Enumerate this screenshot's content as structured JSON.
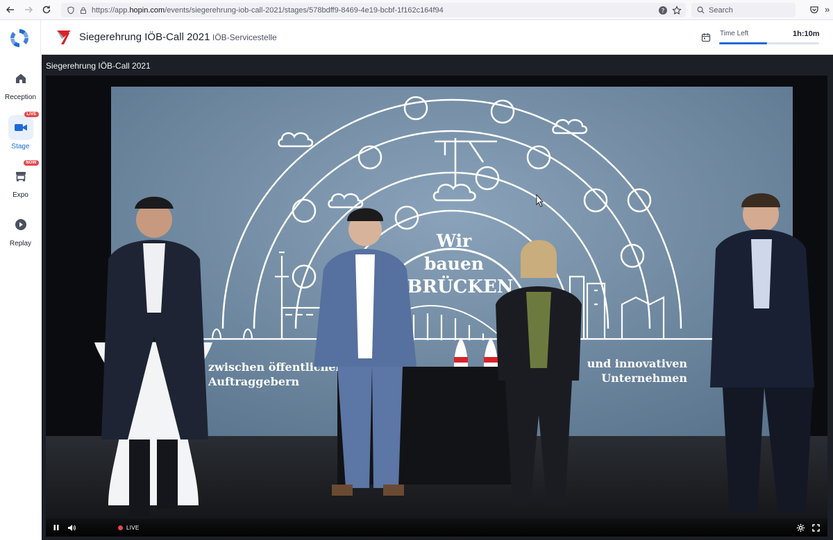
{
  "browser": {
    "url_prefix": "https://app.",
    "url_domain": "hopin.com",
    "url_path": "/events/siegerehrung-iob-call-2021/stages/578bdff9-8469-4e19-bcbf-1f162c164f94",
    "search_placeholder": "Search"
  },
  "sidebar": {
    "items": [
      {
        "label": "Reception",
        "badge": ""
      },
      {
        "label": "Stage",
        "badge": "LIVE"
      },
      {
        "label": "Expo",
        "badge": "NOW"
      },
      {
        "label": "Replay",
        "badge": ""
      }
    ]
  },
  "header": {
    "title": "Siegerehrung IÖB-Call 2021",
    "organizer": "IÖB-Servicestelle",
    "time_left_label": "Time Left",
    "time_left_value": "1h:10m",
    "time_left_progress": 0.48
  },
  "stage": {
    "title": "Siegerehrung IÖB-Call 2021",
    "backdrop": {
      "line1": "Wir",
      "line2": "bauen",
      "line3": "BRÜCKEN",
      "left_caption_1": "zwischen öffentlichen",
      "left_caption_2": "Auftraggebern",
      "right_caption_1": "und innovativen",
      "right_caption_2": "Unternehmen"
    },
    "live_label": "LIVE"
  },
  "colors": {
    "accent": "#1e6ad6",
    "live": "#e5484d",
    "backdrop": "#6f8aa3"
  }
}
